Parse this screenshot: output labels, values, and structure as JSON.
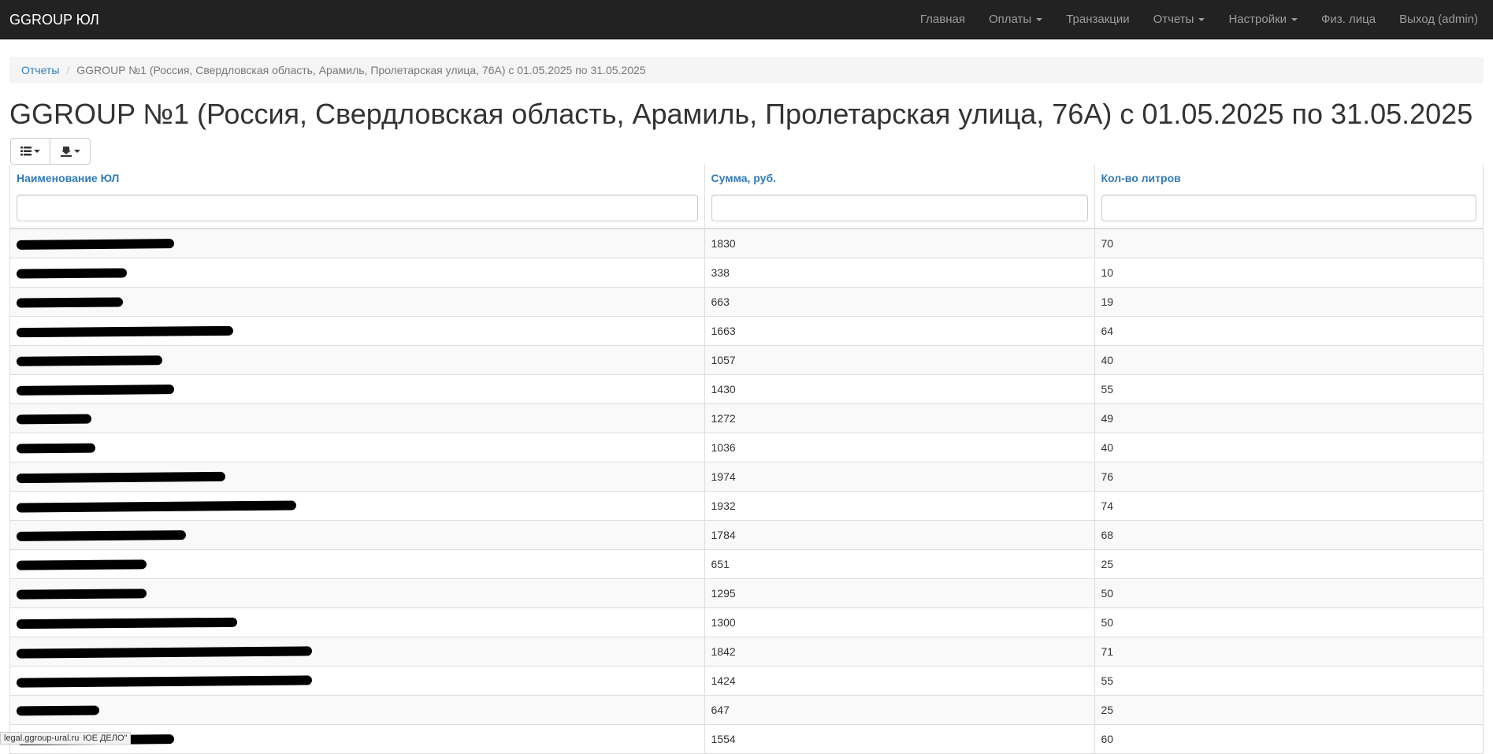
{
  "navbar": {
    "brand": "GGROUP ЮЛ",
    "items": [
      {
        "label": "Главная",
        "dropdown": false
      },
      {
        "label": "Оплаты",
        "dropdown": true
      },
      {
        "label": "Транзакции",
        "dropdown": false
      },
      {
        "label": "Отчеты",
        "dropdown": true
      },
      {
        "label": "Настройки",
        "dropdown": true
      },
      {
        "label": "Физ. лица",
        "dropdown": false
      },
      {
        "label": "Выход (admin)",
        "dropdown": false
      }
    ]
  },
  "breadcrumb": {
    "link": "Отчеты",
    "separator": "/",
    "active": "GGROUP №1 (Россия, Свердловская область, Арамиль, Пролетарская улица, 76А) с 01.05.2025 по 31.05.2025"
  },
  "page_title": "GGROUP №1 (Россия, Свердловская область, Арамиль, Пролетарская улица, 76А) с 01.05.2025 по 31.05.2025",
  "toolbar": {
    "columns_icon": "list-icon",
    "export_icon": "export-icon"
  },
  "table": {
    "columns": [
      "Наименование ЮЛ",
      "Сумма, руб.",
      "Кол-во литров"
    ],
    "filters": [
      "",
      "",
      ""
    ],
    "rows": [
      {
        "sum": "1830",
        "liters": "70"
      },
      {
        "sum": "338",
        "liters": "10"
      },
      {
        "sum": "663",
        "liters": "19"
      },
      {
        "sum": "1663",
        "liters": "64"
      },
      {
        "sum": "1057",
        "liters": "40"
      },
      {
        "sum": "1430",
        "liters": "55"
      },
      {
        "sum": "1272",
        "liters": "49"
      },
      {
        "sum": "1036",
        "liters": "40"
      },
      {
        "sum": "1974",
        "liters": "76"
      },
      {
        "sum": "1932",
        "liters": "74"
      },
      {
        "sum": "1784",
        "liters": "68"
      },
      {
        "sum": "651",
        "liters": "25"
      },
      {
        "sum": "1295",
        "liters": "50"
      },
      {
        "sum": "1300",
        "liters": "50"
      },
      {
        "sum": "1842",
        "liters": "71"
      },
      {
        "sum": "1424",
        "liters": "55"
      },
      {
        "sum": "647",
        "liters": "25"
      },
      {
        "sum": "1554",
        "liters": "60"
      }
    ]
  },
  "status_bar": {
    "text": "legal.ggroup-ural.ru",
    "overlay_text": "ЮЕ ДЕЛО\""
  }
}
